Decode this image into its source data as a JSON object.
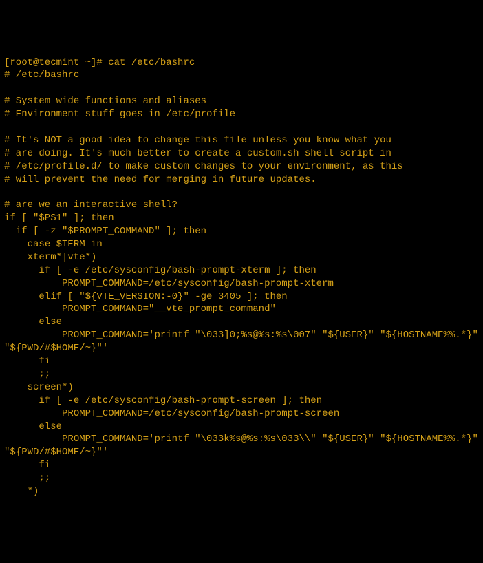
{
  "terminal": {
    "prompt": "[root@tecmint ~]# cat /etc/bashrc",
    "lines": [
      "# /etc/bashrc",
      "",
      "# System wide functions and aliases",
      "# Environment stuff goes in /etc/profile",
      "",
      "# It's NOT a good idea to change this file unless you know what you",
      "# are doing. It's much better to create a custom.sh shell script in",
      "# /etc/profile.d/ to make custom changes to your environment, as this",
      "# will prevent the need for merging in future updates.",
      "",
      "# are we an interactive shell?",
      "if [ \"$PS1\" ]; then",
      "  if [ -z \"$PROMPT_COMMAND\" ]; then",
      "    case $TERM in",
      "    xterm*|vte*)",
      "      if [ -e /etc/sysconfig/bash-prompt-xterm ]; then",
      "          PROMPT_COMMAND=/etc/sysconfig/bash-prompt-xterm",
      "      elif [ \"${VTE_VERSION:-0}\" -ge 3405 ]; then",
      "          PROMPT_COMMAND=\"__vte_prompt_command\"",
      "      else",
      "          PROMPT_COMMAND='printf \"\\033]0;%s@%s:%s\\007\" \"${USER}\" \"${HOSTNAME%%.*}\" \"${PWD/#$HOME/~}\"'",
      "      fi",
      "      ;;",
      "    screen*)",
      "      if [ -e /etc/sysconfig/bash-prompt-screen ]; then",
      "          PROMPT_COMMAND=/etc/sysconfig/bash-prompt-screen",
      "      else",
      "          PROMPT_COMMAND='printf \"\\033k%s@%s:%s\\033\\\\\" \"${USER}\" \"${HOSTNAME%%.*}\" \"${PWD/#$HOME/~}\"'",
      "      fi",
      "      ;;",
      "    *)"
    ]
  }
}
